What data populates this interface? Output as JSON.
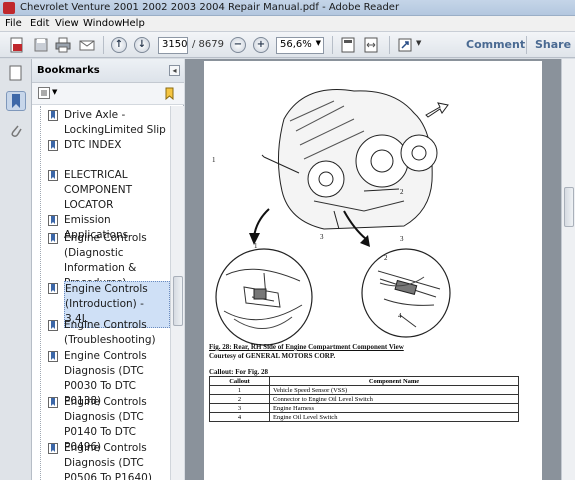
{
  "window": {
    "title": "Chevrolet Venture 2001 2002 2003 2004 Repair Manual.pdf - Adobe Reader"
  },
  "menu": {
    "items": [
      "File",
      "Edit",
      "View",
      "Window",
      "Help"
    ]
  },
  "toolbar": {
    "page_current": "3150",
    "page_total": "/ 8679",
    "zoom": "56,6%",
    "comment_label": "Comment",
    "share_label": "Share"
  },
  "bookmarks": {
    "title": "Bookmarks",
    "items": [
      {
        "label": "Drive Axle - LockingLimited Slip",
        "selected": false
      },
      {
        "label": "DTC INDEX",
        "selected": false
      },
      {
        "label": "ELECTRICAL COMPONENT LOCATOR",
        "selected": false
      },
      {
        "label": "Emission Applications",
        "selected": false
      },
      {
        "label": "Engine Controls (Diagnostic Information & Procedures)",
        "selected": false
      },
      {
        "label": "Engine Controls (Introduction) - 3.4L",
        "selected": true
      },
      {
        "label": "Engine Controls (Troubleshooting)",
        "selected": false
      },
      {
        "label": "Engine Controls Diagnosis (DTC P0030 To DTC P0138)",
        "selected": false
      },
      {
        "label": "Engine Controls Diagnosis (DTC P0140 To DTC P0496)",
        "selected": false
      },
      {
        "label": "Engine Controls Diagnosis (DTC P0506 To P1640)",
        "selected": false
      }
    ]
  },
  "document": {
    "figure_caption": "Fig. 28: Rear, RH Side of Engine Compartment Component View",
    "courtesy": "Courtesy of GENERAL MOTORS CORP.",
    "callout_title": "Callout: For Fig. 28",
    "table": {
      "headers": [
        "Callout",
        "Component Name"
      ],
      "rows": [
        [
          "1",
          "Vehicle Speed Sensor (VSS)"
        ],
        [
          "2",
          "Connector to Engine Oil Level Switch"
        ],
        [
          "3",
          "Engine Harness"
        ],
        [
          "4",
          "Engine Oil Level Switch"
        ]
      ]
    },
    "diagram_labels": {
      "n1": "1",
      "n2": "2",
      "n3": "3",
      "n1b": "1",
      "n3b": "3",
      "n2b": "2",
      "n4": "4"
    }
  },
  "colors": {
    "accent": "#4a6a92",
    "selection": "#cfe0f6",
    "acrobat_red": "#c0282d"
  }
}
